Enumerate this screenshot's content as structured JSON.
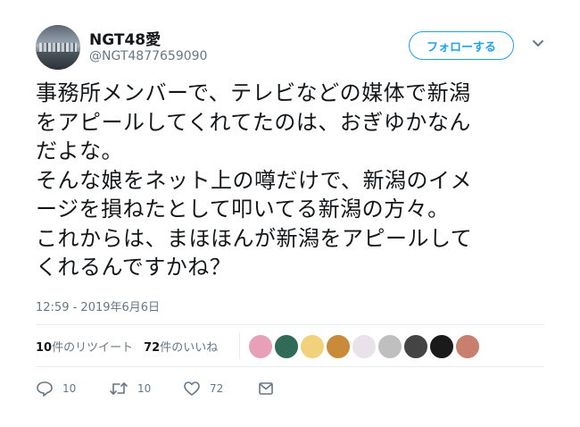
{
  "user": {
    "display_name": "NGT48愛",
    "handle": "@NGT4877659090",
    "avatar_icon": "avatar-city-skyline"
  },
  "follow_button": {
    "label": "フォローする"
  },
  "menu": {
    "icon": "chevron-down-icon"
  },
  "tweet": {
    "text": "事務所メンバーで、テレビなどの媒体で新潟\nをアピールしてくれてたのは、おぎゆかなん\nだよな。\nそんな娘をネット上の噂だけで、新潟のイメ\nージを損ねたとして叩いてる新潟の方々。\nこれからは、まほほんが新潟をアピールして\nくれるんですかね？",
    "timestamp": "12:59 - 2019年6月6日"
  },
  "stats": {
    "retweets_count": "10",
    "retweets_label": "件のリツイート",
    "likes_count": "72",
    "likes_label": "件のいいね"
  },
  "likers": [
    {
      "name": "liker-avatar",
      "color": "#e8a0b8"
    },
    {
      "name": "liker-avatar",
      "color": "#2f6b57"
    },
    {
      "name": "liker-avatar",
      "color": "#f1d27a"
    },
    {
      "name": "liker-avatar",
      "color": "#c98a3a"
    },
    {
      "name": "liker-avatar",
      "color": "#e9e2ea"
    },
    {
      "name": "liker-avatar",
      "color": "#bfbfbf"
    },
    {
      "name": "liker-avatar",
      "color": "#444444"
    },
    {
      "name": "liker-avatar",
      "color": "#1a1a1a"
    },
    {
      "name": "liker-avatar",
      "color": "#c97f6e"
    }
  ],
  "actions": {
    "reply_count": "10",
    "retweet_count": "10",
    "like_count": "72"
  },
  "colors": {
    "accent": "#1da1f2",
    "secondary_text": "#657786",
    "divider": "#e6ecf0"
  }
}
